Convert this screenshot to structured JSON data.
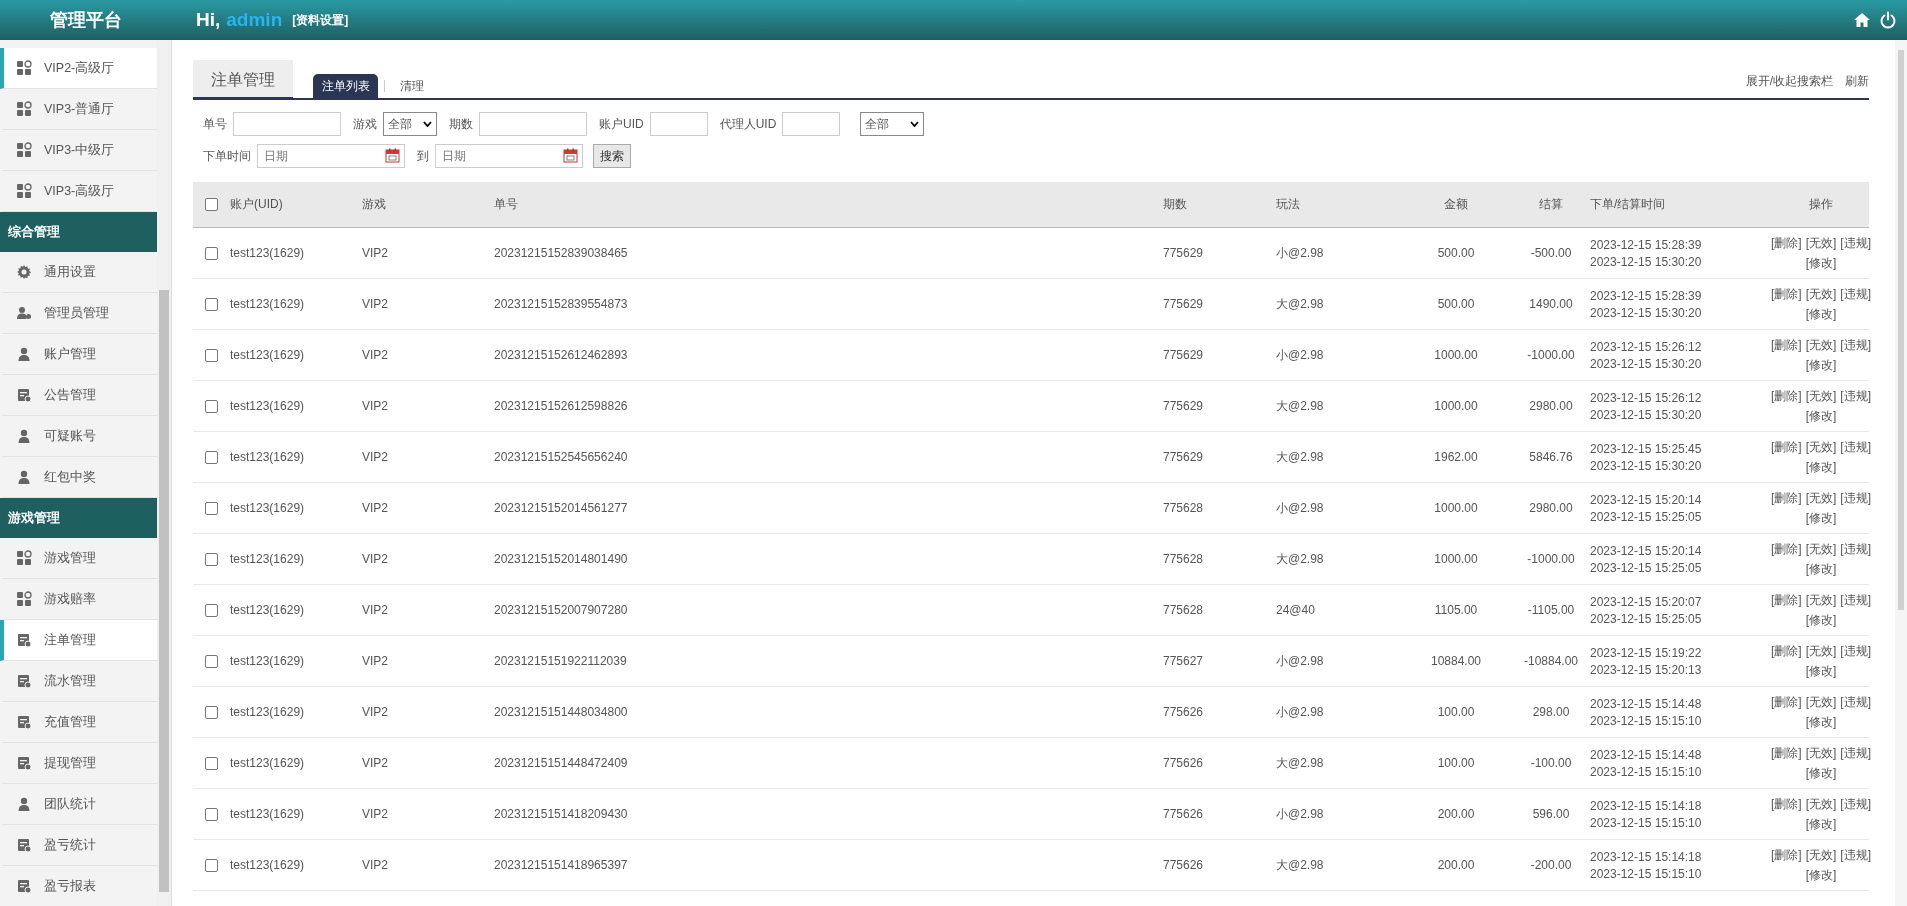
{
  "header": {
    "brand": "管理平台",
    "greeting": "Hi,",
    "user": "admin",
    "profile_link": "[资料设置]"
  },
  "sidebar": {
    "sections": [
      {
        "items": [
          {
            "label": "VIP2-高级厅",
            "kind": "grid",
            "selected": true
          },
          {
            "label": "VIP3-普通厅",
            "kind": "grid",
            "selected": false
          },
          {
            "label": "VIP3-中级厅",
            "kind": "grid",
            "selected": false
          },
          {
            "label": "VIP3-高级厅",
            "kind": "grid",
            "selected": false
          }
        ]
      },
      {
        "title": "综合管理",
        "items": [
          {
            "label": "通用设置",
            "kind": "gear",
            "selected": false
          },
          {
            "label": "管理员管理",
            "kind": "admin",
            "selected": false
          },
          {
            "label": "账户管理",
            "kind": "user",
            "selected": false
          },
          {
            "label": "公告管理",
            "kind": "doc",
            "selected": false
          },
          {
            "label": "可疑账号",
            "kind": "user",
            "selected": false
          },
          {
            "label": "红包中奖",
            "kind": "user",
            "selected": false
          }
        ]
      },
      {
        "title": "游戏管理",
        "items": [
          {
            "label": "游戏管理",
            "kind": "grid",
            "selected": false
          },
          {
            "label": "游戏赔率",
            "kind": "grid",
            "selected": false
          },
          {
            "label": "注单管理",
            "kind": "doc",
            "selected": true
          },
          {
            "label": "流水管理",
            "kind": "doc",
            "selected": false
          },
          {
            "label": "充值管理",
            "kind": "doc",
            "selected": false
          },
          {
            "label": "提现管理",
            "kind": "doc",
            "selected": false
          },
          {
            "label": "团队统计",
            "kind": "user",
            "selected": false
          },
          {
            "label": "盈亏统计",
            "kind": "doc",
            "selected": false
          },
          {
            "label": "盈亏报表",
            "kind": "doc",
            "selected": false
          }
        ]
      }
    ]
  },
  "page": {
    "title": "注单管理",
    "tabs": [
      {
        "label": "注单列表",
        "selected": true
      },
      {
        "label": "清理",
        "selected": false
      }
    ],
    "actions": [
      "展开/收起搜索栏",
      "刷新"
    ]
  },
  "filters": {
    "order_no": {
      "label": "单号"
    },
    "game": {
      "label": "游戏",
      "value": "全部"
    },
    "period": {
      "label": "期数"
    },
    "account_uid": {
      "label": "账户UID"
    },
    "agent_uid": {
      "label": "代理人UID"
    },
    "type_select": {
      "value": "全部"
    },
    "time_from": {
      "label": "下单时间",
      "placeholder": "日期"
    },
    "time_to": {
      "label": "到",
      "placeholder": "日期"
    },
    "search_button": "搜索"
  },
  "table": {
    "select_all": {
      "checked": false
    },
    "columns": [
      "账户(UID)",
      "游戏",
      "单号",
      "期数",
      "玩法",
      "金额",
      "结算",
      "下单/结算时间",
      "操作"
    ],
    "rows": [
      {
        "checked": false,
        "account": "test123(1629)",
        "game": "VIP2",
        "order_no": "20231215152839038465",
        "period": "775629",
        "play": "小@2.98",
        "amount": "500.00",
        "settlement": "-500.00",
        "order_time": "2023-12-15 15:28:39",
        "settle_time": "2023-12-15 15:30:20",
        "actions": [
          "[删除]",
          "[无效]",
          "[违规]",
          "[修改]"
        ]
      },
      {
        "checked": false,
        "account": "test123(1629)",
        "game": "VIP2",
        "order_no": "20231215152839554873",
        "period": "775629",
        "play": "大@2.98",
        "amount": "500.00",
        "settlement": "1490.00",
        "order_time": "2023-12-15 15:28:39",
        "settle_time": "2023-12-15 15:30:20",
        "actions": [
          "[删除]",
          "[无效]",
          "[违规]",
          "[修改]"
        ]
      },
      {
        "checked": false,
        "account": "test123(1629)",
        "game": "VIP2",
        "order_no": "20231215152612462893",
        "period": "775629",
        "play": "小@2.98",
        "amount": "1000.00",
        "settlement": "-1000.00",
        "order_time": "2023-12-15 15:26:12",
        "settle_time": "2023-12-15 15:30:20",
        "actions": [
          "[删除]",
          "[无效]",
          "[违规]",
          "[修改]"
        ]
      },
      {
        "checked": false,
        "account": "test123(1629)",
        "game": "VIP2",
        "order_no": "20231215152612598826",
        "period": "775629",
        "play": "大@2.98",
        "amount": "1000.00",
        "settlement": "2980.00",
        "order_time": "2023-12-15 15:26:12",
        "settle_time": "2023-12-15 15:30:20",
        "actions": [
          "[删除]",
          "[无效]",
          "[违规]",
          "[修改]"
        ]
      },
      {
        "checked": false,
        "account": "test123(1629)",
        "game": "VIP2",
        "order_no": "20231215152545656240",
        "period": "775629",
        "play": "大@2.98",
        "amount": "1962.00",
        "settlement": "5846.76",
        "order_time": "2023-12-15 15:25:45",
        "settle_time": "2023-12-15 15:30:20",
        "actions": [
          "[删除]",
          "[无效]",
          "[违规]",
          "[修改]"
        ]
      },
      {
        "checked": false,
        "account": "test123(1629)",
        "game": "VIP2",
        "order_no": "20231215152014561277",
        "period": "775628",
        "play": "小@2.98",
        "amount": "1000.00",
        "settlement": "2980.00",
        "order_time": "2023-12-15 15:20:14",
        "settle_time": "2023-12-15 15:25:05",
        "actions": [
          "[删除]",
          "[无效]",
          "[违规]",
          "[修改]"
        ]
      },
      {
        "checked": false,
        "account": "test123(1629)",
        "game": "VIP2",
        "order_no": "20231215152014801490",
        "period": "775628",
        "play": "大@2.98",
        "amount": "1000.00",
        "settlement": "-1000.00",
        "order_time": "2023-12-15 15:20:14",
        "settle_time": "2023-12-15 15:25:05",
        "actions": [
          "[删除]",
          "[无效]",
          "[违规]",
          "[修改]"
        ]
      },
      {
        "checked": false,
        "account": "test123(1629)",
        "game": "VIP2",
        "order_no": "20231215152007907280",
        "period": "775628",
        "play": "24@40",
        "amount": "1105.00",
        "settlement": "-1105.00",
        "order_time": "2023-12-15 15:20:07",
        "settle_time": "2023-12-15 15:25:05",
        "actions": [
          "[删除]",
          "[无效]",
          "[违规]",
          "[修改]"
        ]
      },
      {
        "checked": false,
        "account": "test123(1629)",
        "game": "VIP2",
        "order_no": "20231215151922112039",
        "period": "775627",
        "play": "小@2.98",
        "amount": "10884.00",
        "settlement": "-10884.00",
        "order_time": "2023-12-15 15:19:22",
        "settle_time": "2023-12-15 15:20:13",
        "actions": [
          "[删除]",
          "[无效]",
          "[违规]",
          "[修改]"
        ]
      },
      {
        "checked": false,
        "account": "test123(1629)",
        "game": "VIP2",
        "order_no": "20231215151448034800",
        "period": "775626",
        "play": "小@2.98",
        "amount": "100.00",
        "settlement": "298.00",
        "order_time": "2023-12-15 15:14:48",
        "settle_time": "2023-12-15 15:15:10",
        "actions": [
          "[删除]",
          "[无效]",
          "[违规]",
          "[修改]"
        ]
      },
      {
        "checked": false,
        "account": "test123(1629)",
        "game": "VIP2",
        "order_no": "20231215151448472409",
        "period": "775626",
        "play": "大@2.98",
        "amount": "100.00",
        "settlement": "-100.00",
        "order_time": "2023-12-15 15:14:48",
        "settle_time": "2023-12-15 15:15:10",
        "actions": [
          "[删除]",
          "[无效]",
          "[违规]",
          "[修改]"
        ]
      },
      {
        "checked": false,
        "account": "test123(1629)",
        "game": "VIP2",
        "order_no": "20231215151418209430",
        "period": "775626",
        "play": "小@2.98",
        "amount": "200.00",
        "settlement": "596.00",
        "order_time": "2023-12-15 15:14:18",
        "settle_time": "2023-12-15 15:15:10",
        "actions": [
          "[删除]",
          "[无效]",
          "[违规]",
          "[修改]"
        ]
      },
      {
        "checked": false,
        "account": "test123(1629)",
        "game": "VIP2",
        "order_no": "20231215151418965397",
        "period": "775626",
        "play": "大@2.98",
        "amount": "200.00",
        "settlement": "-200.00",
        "order_time": "2023-12-15 15:14:18",
        "settle_time": "2023-12-15 15:15:10",
        "actions": [
          "[删除]",
          "[无效]",
          "[违规]",
          "[修改]"
        ]
      }
    ]
  }
}
